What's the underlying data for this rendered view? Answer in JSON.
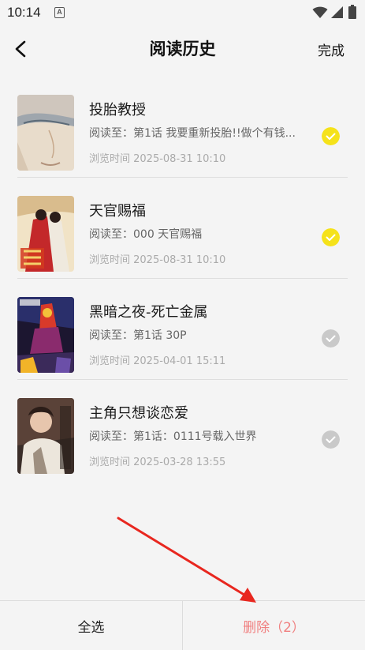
{
  "status_bar": {
    "time": "10:14",
    "notification_icon_letter": "A",
    "icons": [
      "wifi-icon",
      "signal-icon",
      "battery-icon"
    ]
  },
  "header": {
    "back_icon": "chevron-left-icon",
    "title": "阅读历史",
    "done_label": "完成"
  },
  "items": [
    {
      "title": "投胎教授",
      "progress": "阅读至：第1话 我要重新投胎!!做个有钱...",
      "time": "浏览时间 2025-08-31 10:10",
      "selected": true
    },
    {
      "title": "天官赐福",
      "progress": "阅读至：000 天官赐福",
      "time": "浏览时间 2025-08-31 10:10",
      "selected": true
    },
    {
      "title": "黑暗之夜-死亡金属",
      "progress": "阅读至：第1话 30P",
      "time": "浏览时间 2025-04-01 15:11",
      "selected": false
    },
    {
      "title": "主角只想谈恋爱",
      "progress": "阅读至：第1话：0111号载入世界",
      "time": "浏览时间 2025-03-28 13:55",
      "selected": false
    }
  ],
  "bottom_bar": {
    "select_all_label": "全选",
    "delete_label": "删除（2）"
  },
  "colors": {
    "selected_check": "#f5e21a",
    "unselected_check": "#c9c9c9",
    "delete_text": "#f08080",
    "annotation_arrow": "#e8271f"
  }
}
